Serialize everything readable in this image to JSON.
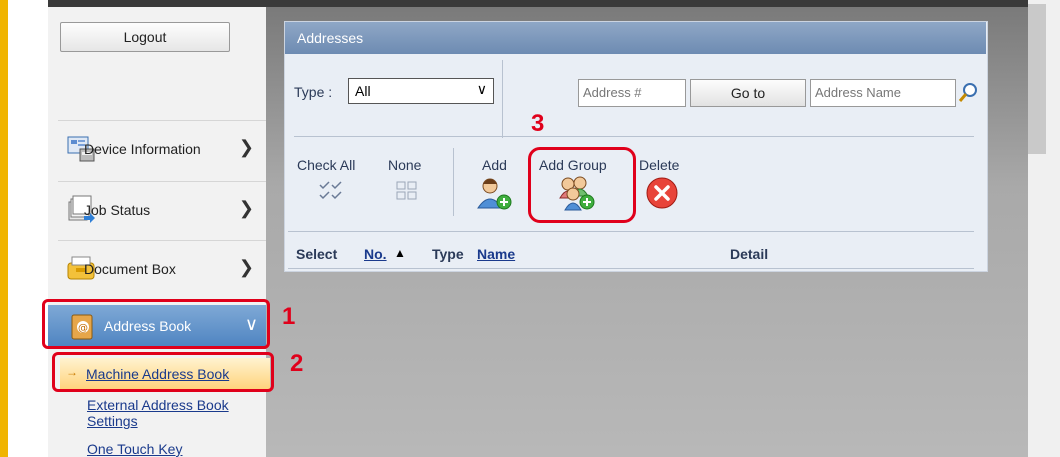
{
  "sidebar": {
    "logout_label": "Logout",
    "nav": [
      {
        "label": "Device Information",
        "icon": "device-info-icon"
      },
      {
        "label": "Job Status",
        "icon": "job-status-icon"
      },
      {
        "label": "Document Box",
        "icon": "document-box-icon"
      },
      {
        "label": "Address Book",
        "icon": "address-book-icon"
      }
    ],
    "sub_items": [
      {
        "label": "Machine Address Book"
      },
      {
        "label": "External Address Book Settings"
      },
      {
        "label": "One Touch Key"
      }
    ]
  },
  "steps": {
    "one": "1",
    "two": "2",
    "three": "3"
  },
  "panel": {
    "title": "Addresses",
    "type_label": "Type :",
    "type_value": "All",
    "address_number_placeholder": "Address #",
    "goto_label": "Go to",
    "address_name_placeholder": "Address Name",
    "toolbar": {
      "check_all": "Check All",
      "none": "None",
      "add": "Add",
      "add_group": "Add Group",
      "delete": "Delete"
    },
    "columns": {
      "select": "Select",
      "no": "No.",
      "sort_indicator": "▲",
      "type": "Type",
      "name": "Name",
      "detail": "Detail"
    }
  },
  "colors": {
    "accent_red": "#e0001b",
    "frame_yellow": "#f0b400",
    "header_blue": "#6d8bb2"
  }
}
